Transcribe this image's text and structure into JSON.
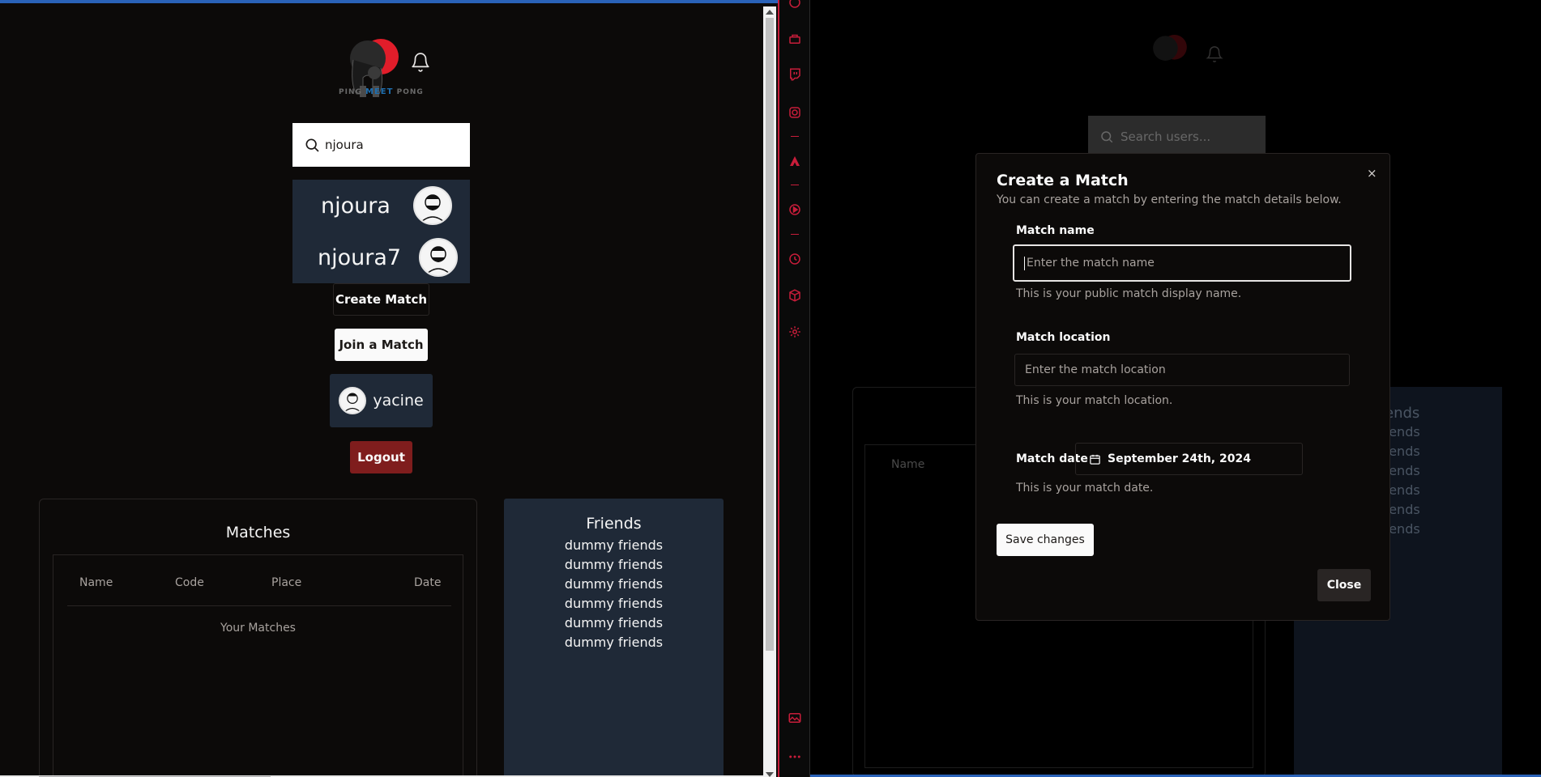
{
  "left": {
    "logo": {
      "ping": "PING",
      "meet": "MEET",
      "pong": "PONG"
    },
    "search": {
      "value": "njoura"
    },
    "results": [
      {
        "name": "njoura"
      },
      {
        "name": "njoura7"
      }
    ],
    "create_match_label": "Create Match",
    "join_match_label": "Join a Match",
    "user": {
      "name": "yacine"
    },
    "logout_label": "Logout",
    "matches": {
      "title": "Matches",
      "columns": [
        "Name",
        "Code",
        "Place",
        "Date"
      ],
      "caption": "Your Matches"
    },
    "friends": {
      "title": "Friends",
      "items": [
        "dummy friends",
        "dummy friends",
        "dummy friends",
        "dummy friends",
        "dummy friends",
        "dummy friends"
      ]
    }
  },
  "right": {
    "background": {
      "search_placeholder": "Search users...",
      "name_header": "Name",
      "friends_title_fragment": "ends",
      "friends_fragments": [
        "y friends",
        "y friends",
        "y friends",
        "y friends",
        "y friends",
        "y friends"
      ]
    },
    "modal": {
      "title": "Create a Match",
      "description": "You can create a match by entering the match details below.",
      "close_x": "×",
      "name_label": "Match name",
      "name_placeholder": "Enter the match name",
      "name_hint": "This is your public match display name.",
      "location_label": "Match location",
      "location_placeholder": "Enter the match location",
      "location_hint": "This is your match location.",
      "date_label": "Match date",
      "date_value": "September 24th, 2024",
      "date_hint": "This is your match date.",
      "save_label": "Save changes",
      "close_label": "Close"
    }
  },
  "colors": {
    "accent_red": "#c81d3a",
    "logout_red": "#7f1d1d",
    "card_bg": "#1f2937",
    "window_border": "#2a62b8"
  }
}
